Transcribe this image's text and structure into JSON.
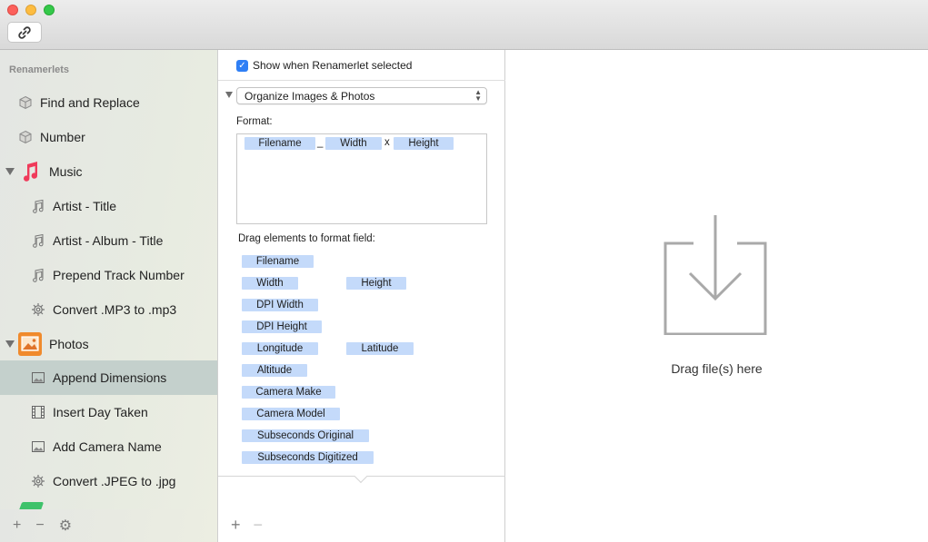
{
  "toolbar": {
    "link_button": "link-icon"
  },
  "sidebar": {
    "header": "Renamerlets",
    "items": [
      {
        "label": "Find and Replace",
        "icon": "cube-icon"
      },
      {
        "label": "Number",
        "icon": "cube-icon"
      },
      {
        "label": "Music",
        "icon": "music-folder-icon"
      },
      {
        "label": "Artist - Title",
        "icon": "music-note-icon"
      },
      {
        "label": "Artist - Album - Title",
        "icon": "music-note-icon"
      },
      {
        "label": "Prepend Track Number",
        "icon": "music-note-icon"
      },
      {
        "label": "Convert .MP3 to .mp3",
        "icon": "gear-icon"
      },
      {
        "label": "Photos",
        "icon": "photos-folder-icon"
      },
      {
        "label": "Append Dimensions",
        "icon": "image-icon",
        "selected": true
      },
      {
        "label": "Insert Day Taken",
        "icon": "film-icon"
      },
      {
        "label": "Add Camera Name",
        "icon": "image-icon"
      },
      {
        "label": "Convert .JPEG to .jpg",
        "icon": "gear-icon"
      }
    ],
    "footer": {
      "add": "+",
      "remove": "−",
      "settings": "⚙"
    }
  },
  "middle": {
    "show_when_selected": "Show when Renamerlet selected",
    "group_select": "Organize Images & Photos",
    "format_label": "Format:",
    "format_tokens": [
      "Filename",
      "_",
      "Width",
      "x",
      "Height"
    ],
    "drag_label": "Drag elements to format field:",
    "elements": [
      "Filename",
      "Width",
      "Height",
      "DPI Width",
      "DPI Height",
      "Longitude",
      "Latitude",
      "Altitude",
      "Camera Make",
      "Camera Model",
      "Subseconds Original",
      "Subseconds Digitized"
    ],
    "footer": {
      "add": "+",
      "remove": "−"
    }
  },
  "right": {
    "drop_text": "Drag file(s) here"
  },
  "colors": {
    "token_bg": "#c4dafa",
    "selected_row": "#c4d0cc",
    "checkbox": "#2f7ff5"
  }
}
